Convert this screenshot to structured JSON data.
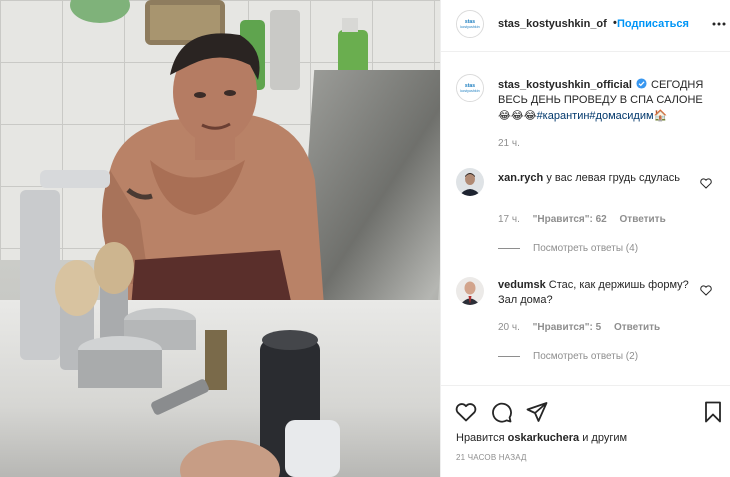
{
  "post": {
    "author": "stas_kostyushkin_official",
    "header_username": "stas_kostyushkin_of",
    "follow_label": "Подписаться",
    "dot": "•",
    "avatar_text": "stas­kostyushkin",
    "caption": {
      "text_a": "СЕГОДНЯ ВЕСЬ ДЕНЬ ПРОВЕДУ В СПА САЛОНЕ ",
      "emojis": "😂😂😂",
      "hashtag1": "#карантин",
      "hashtag2": "#домасидим",
      "house_emoji": "🏠",
      "time": "21 ч."
    },
    "comments": [
      {
        "user": "xan.rych",
        "text": "у вас левая грудь сдулась",
        "time": "17 ч.",
        "likes": "\"Нравится\": 62",
        "reply": "Ответить",
        "view_replies": "Посмотреть ответы (4)"
      },
      {
        "user": "vedumsk",
        "text": "Стас, как держишь форму? Зал дома?",
        "time": "20 ч.",
        "likes": "\"Нравится\": 5",
        "reply": "Ответить",
        "view_replies": "Посмотреть ответы (2)"
      }
    ],
    "likes_prefix": "Нравится",
    "liked_by": "oskarkuchera",
    "likes_suffix": "и другим",
    "date": "21 ЧАСОВ НАЗАД"
  },
  "icons": {
    "more": "more-options-icon",
    "like": "heart-icon",
    "comment": "comment-icon",
    "share": "paper-plane-icon",
    "save": "bookmark-icon",
    "verified": "verified-badge-icon"
  },
  "colors": {
    "accent": "#0095f6",
    "hashtag": "#00376b",
    "muted": "#8e8e8e",
    "text": "#262626",
    "verified": "#3897f0"
  }
}
